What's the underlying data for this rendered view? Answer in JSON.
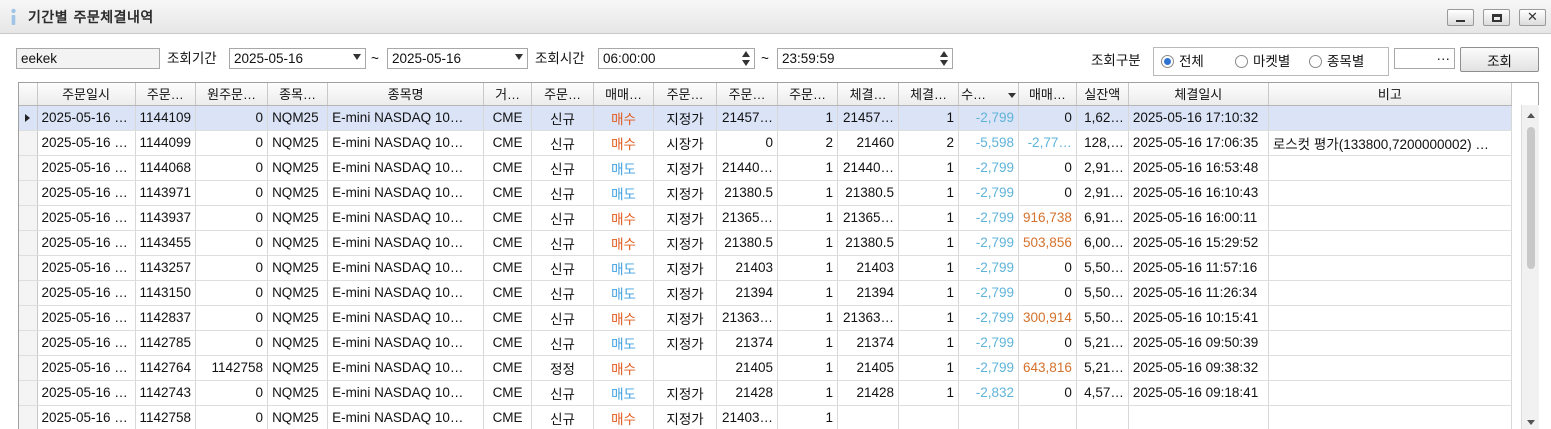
{
  "window": {
    "title": "기간별 주문체결내역",
    "controls": {
      "minimize": "–",
      "maximize": "□",
      "close": "✕"
    },
    "icon": "info-icon"
  },
  "toolbar": {
    "account_value": "eekek",
    "account_name_value": "",
    "period_label": "조회기간",
    "date_from": "2025-05-16",
    "tilde1": "~",
    "date_to": "2025-05-16",
    "time_label": "조회시간",
    "time_from": "06:00:00",
    "tilde2": "~",
    "time_to": "23:59:59",
    "category_label": "조회구분",
    "radio_options": [
      {
        "label": "전체",
        "checked": true
      },
      {
        "label": "마켓별",
        "checked": false
      },
      {
        "label": "종목별",
        "checked": false
      }
    ],
    "filter_value": "···",
    "search_button": "조회"
  },
  "table": {
    "columns": [
      "주문일시",
      "주문…",
      "원주문…",
      "종목…",
      "종목명",
      "거…",
      "주문…",
      "매매…",
      "주문…",
      "주문…",
      "주문…",
      "체결…",
      "체결…",
      "수…",
      "매매…",
      "실잔액",
      "체결일시",
      "비고"
    ],
    "rows": [
      [
        "2025-05-16 …",
        "1144109",
        "0",
        "NQM25",
        "E-mini NASDAQ 10…",
        "CME",
        "신규",
        "매수",
        "지정가",
        "21457…",
        "1",
        "21457…",
        "1",
        "-2,799",
        "0",
        "1,62…",
        "2025-05-16 17:10:32",
        ""
      ],
      [
        "2025-05-16 …",
        "1144099",
        "0",
        "NQM25",
        "E-mini NASDAQ 10…",
        "CME",
        "신규",
        "매수",
        "시장가",
        "0",
        "2",
        "21460",
        "2",
        "-5,598",
        "-2,77…",
        "128,…",
        "2025-05-16 17:06:35",
        "로스컷 평가(133800,7200000002) …"
      ],
      [
        "2025-05-16 …",
        "1144068",
        "0",
        "NQM25",
        "E-mini NASDAQ 10…",
        "CME",
        "신규",
        "매도",
        "지정가",
        "21440…",
        "1",
        "21440…",
        "1",
        "-2,799",
        "0",
        "2,91…",
        "2025-05-16 16:53:48",
        ""
      ],
      [
        "2025-05-16 …",
        "1143971",
        "0",
        "NQM25",
        "E-mini NASDAQ 10…",
        "CME",
        "신규",
        "매도",
        "지정가",
        "21380.5",
        "1",
        "21380.5",
        "1",
        "-2,799",
        "0",
        "2,91…",
        "2025-05-16 16:10:43",
        ""
      ],
      [
        "2025-05-16 …",
        "1143937",
        "0",
        "NQM25",
        "E-mini NASDAQ 10…",
        "CME",
        "신규",
        "매수",
        "지정가",
        "21365…",
        "1",
        "21365…",
        "1",
        "-2,799",
        "916,738",
        "6,91…",
        "2025-05-16 16:00:11",
        ""
      ],
      [
        "2025-05-16 …",
        "1143455",
        "0",
        "NQM25",
        "E-mini NASDAQ 10…",
        "CME",
        "신규",
        "매수",
        "지정가",
        "21380.5",
        "1",
        "21380.5",
        "1",
        "-2,799",
        "503,856",
        "6,00…",
        "2025-05-16 15:29:52",
        ""
      ],
      [
        "2025-05-16 …",
        "1143257",
        "0",
        "NQM25",
        "E-mini NASDAQ 10…",
        "CME",
        "신규",
        "매도",
        "지정가",
        "21403",
        "1",
        "21403",
        "1",
        "-2,799",
        "0",
        "5,50…",
        "2025-05-16 11:57:16",
        ""
      ],
      [
        "2025-05-16 …",
        "1143150",
        "0",
        "NQM25",
        "E-mini NASDAQ 10…",
        "CME",
        "신규",
        "매도",
        "지정가",
        "21394",
        "1",
        "21394",
        "1",
        "-2,799",
        "0",
        "5,50…",
        "2025-05-16 11:26:34",
        ""
      ],
      [
        "2025-05-16 …",
        "1142837",
        "0",
        "NQM25",
        "E-mini NASDAQ 10…",
        "CME",
        "신규",
        "매수",
        "지정가",
        "21363…",
        "1",
        "21363…",
        "1",
        "-2,799",
        "300,914",
        "5,50…",
        "2025-05-16 10:15:41",
        ""
      ],
      [
        "2025-05-16 …",
        "1142785",
        "0",
        "NQM25",
        "E-mini NASDAQ 10…",
        "CME",
        "신규",
        "매도",
        "지정가",
        "21374",
        "1",
        "21374",
        "1",
        "-2,799",
        "0",
        "5,21…",
        "2025-05-16 09:50:39",
        ""
      ],
      [
        "2025-05-16 …",
        "1142764",
        "1142758",
        "NQM25",
        "E-mini NASDAQ 10…",
        "CME",
        "정정",
        "매수",
        "",
        "21405",
        "1",
        "21405",
        "1",
        "-2,799",
        "643,816",
        "5,21…",
        "2025-05-16 09:38:32",
        ""
      ],
      [
        "2025-05-16 …",
        "1142743",
        "0",
        "NQM25",
        "E-mini NASDAQ 10…",
        "CME",
        "신규",
        "매도",
        "지정가",
        "21428",
        "1",
        "21428",
        "1",
        "-2,832",
        "0",
        "4,57…",
        "2025-05-16 09:18:41",
        ""
      ],
      [
        "2025-05-16 …",
        "1142758",
        "0",
        "NQM25",
        "E-mini NASDAQ 10…",
        "CME",
        "신규",
        "매수",
        "지정가",
        "21403…",
        "1",
        "",
        "",
        "",
        "",
        "",
        "",
        ""
      ]
    ],
    "selected_row": 0
  },
  "colors": {
    "buy": "#e05a1c",
    "sell": "#3fa0e0",
    "negative": "#5fb3d9",
    "pnl": "#d4712b",
    "selected_row": "#dbe4f7"
  }
}
